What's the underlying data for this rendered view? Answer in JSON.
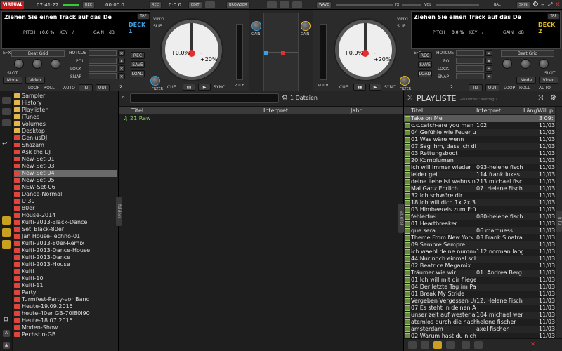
{
  "topbar": {
    "logo": "VIRTUAL DJ",
    "time": "07:41:22",
    "rec_label": "REC",
    "rec_time": "00:00.0",
    "mic_label": "REC",
    "mic_value": "0:0.0",
    "edit_label": "EDIT",
    "browser_label": "BROWSER",
    "wave_label": "WAVE",
    "vol_label": "VOL",
    "bal_label": "BAL",
    "skin_label": "SKIN"
  },
  "deck1": {
    "title": "Ziehen Sie einen Track auf das De",
    "tap": "TAP",
    "deck": "DECK 1",
    "pitch_label": "PITCH",
    "pitch_value": "+0.0 %",
    "key_label": "KEY",
    "key_value": "/",
    "gain_label": "GAIN",
    "gain_value": "dB",
    "fx_label": "EFX",
    "fx_select": "Beat Grid",
    "hotcue": "HOTCUE",
    "poi": "POI",
    "lock": "LOCK",
    "snap": "SNAP",
    "slot": "SLOT",
    "mode": "Mode",
    "video": "Video",
    "loop": "LOOP",
    "roll": "ROLL",
    "auto": "AUTO",
    "in": "IN",
    "out": "OUT",
    "loop_num": "2",
    "rec": "REC",
    "save": "SAVE",
    "load": "LOAD",
    "jog_left": "+0.0%",
    "jog_right": "-+20%",
    "cue": "CUE",
    "sync": "SYNC",
    "vinyl": "VINYL",
    "slip": "SLIP",
    "filter": "FILTER",
    "pitch_side": "PITCH",
    "gain_side": "GAIN"
  },
  "deck2": {
    "title": "Ziehen Sie einen Track auf das De",
    "tap": "TAP",
    "deck": "DECK 2",
    "pitch_label": "PITCH",
    "pitch_value": "+0.0 %",
    "key_label": "KEY",
    "key_value": "/",
    "gain_label": "GAIN",
    "gain_value": "dB",
    "fx_label": "EFX",
    "fx_select": "Beat Grid",
    "hotcue": "HOTCUE",
    "poi": "POI",
    "lock": "LOCK",
    "snap": "SNAP",
    "slot": "SLOT",
    "mode": "Mode",
    "video": "Video",
    "loop": "LOOP",
    "roll": "ROLL",
    "auto": "AUTO",
    "in": "IN",
    "out": "OUT",
    "loop_num": "2",
    "rec": "REC",
    "save": "SAVE",
    "load": "LOAD",
    "jog_left": "+0.0%",
    "jog_right": "-+20%",
    "cue": "CUE",
    "sync": "SYNC",
    "vinyl": "VINYL",
    "slip": "SLIP",
    "filter": "FILTER",
    "pitch_side": "PITCH",
    "gain_side": "GAIN"
  },
  "tree": [
    {
      "label": "Sampler",
      "icon": "folder-yel"
    },
    {
      "label": "History",
      "icon": "folder-yel"
    },
    {
      "label": "Playlisten",
      "icon": "folder-yel"
    },
    {
      "label": "iTunes",
      "icon": "folder-yel"
    },
    {
      "label": "Volumes",
      "icon": "folder-yel"
    },
    {
      "label": "Desktop",
      "icon": "folder-yel"
    },
    {
      "label": "GeniusDJ",
      "icon": "folder-red"
    },
    {
      "label": "Shazam",
      "icon": "folder-red"
    },
    {
      "label": "Ask the DJ",
      "icon": "folder-red"
    },
    {
      "label": "New-Set-01",
      "icon": "folder-red"
    },
    {
      "label": "New-Set-03",
      "icon": "folder-red"
    },
    {
      "label": "New-Set-04",
      "icon": "folder-red"
    },
    {
      "label": "New-Set-05",
      "icon": "folder-red"
    },
    {
      "label": "NEW-Set-06",
      "icon": "folder-red"
    },
    {
      "label": "Dance-Normal",
      "icon": "folder-red"
    },
    {
      "label": "U 30",
      "icon": "folder-red"
    },
    {
      "label": "80er",
      "icon": "folder-red"
    },
    {
      "label": "House-2014",
      "icon": "folder-red"
    },
    {
      "label": "Kulti-2013-Black-Dance",
      "icon": "folder-red"
    },
    {
      "label": "Set_Black-80er",
      "icon": "folder-red"
    },
    {
      "label": "Jan House-Techno-01",
      "icon": "folder-red"
    },
    {
      "label": "Kulti-2013-80er-Remix",
      "icon": "folder-red"
    },
    {
      "label": "Kulti-2013-Dance-House",
      "icon": "folder-red"
    },
    {
      "label": "Kulti-2013-Dance",
      "icon": "folder-red"
    },
    {
      "label": "Kulti-2013-House",
      "icon": "folder-red"
    },
    {
      "label": "Kulti",
      "icon": "folder-red"
    },
    {
      "label": "Kulti-10",
      "icon": "folder-red"
    },
    {
      "label": "Kulti-11",
      "icon": "folder-red"
    },
    {
      "label": "Party",
      "icon": "folder-red"
    },
    {
      "label": "Turmfest-Party-vor Band",
      "icon": "folder-red"
    },
    {
      "label": "Heute-19.09.2015",
      "icon": "folder-red"
    },
    {
      "label": "heute-40er GB-70I80I90",
      "icon": "folder-red"
    },
    {
      "label": "Heute-18.07.2015",
      "icon": "folder-red"
    },
    {
      "label": "Moden-Show",
      "icon": "folder-red"
    },
    {
      "label": "Pechstin-GB",
      "icon": "folder-red"
    }
  ],
  "main": {
    "file_count": "1 Dateien",
    "col_title": "Titel",
    "col_artist": "Interpret",
    "col_year": "Jahr",
    "rows": [
      {
        "title": "21 Raw",
        "artist": "",
        "year": ""
      }
    ],
    "folders_tab": "folders"
  },
  "playlist": {
    "title": "PLAYLISTE",
    "subtitle": "Gesamtzeit: Montag:1",
    "col_title": "Titel",
    "col_artist": "Interpret",
    "col_len": "Läng",
    "col_will": "Will p",
    "sidelist_tab": "sidelist",
    "info_tab": "info",
    "rows": [
      {
        "title": "Take on Me",
        "artist": "",
        "will": "3 09:"
      },
      {
        "title": "c.c.catch-are you man en",
        "artist": "102",
        "will": "11/03"
      },
      {
        "title": "04 Gefühle wie Feuer und",
        "artist": "",
        "will": "11/03"
      },
      {
        "title": "01 Was wäre wenn",
        "artist": "",
        "will": "11/03"
      },
      {
        "title": "07 Sag ihm, dass ich dich",
        "artist": "",
        "will": "11/03"
      },
      {
        "title": "03 Rettungsboot",
        "artist": "",
        "will": "11/03"
      },
      {
        "title": "20 Kornblumen",
        "artist": "",
        "will": "11/03"
      },
      {
        "title": "ich will immer wieder",
        "artist": "093-helene fische",
        "will": "11/03"
      },
      {
        "title": "leider geil",
        "artist": "114 frank lukas",
        "will": "11/03"
      },
      {
        "title": "deine liebe ist wahnsinn",
        "artist": "213 michael fische",
        "will": "11/03"
      },
      {
        "title": "Mal Ganz Ehrlich",
        "artist": "07. Helene Fische",
        "will": "11/03"
      },
      {
        "title": "32 Ich schwöre dir",
        "artist": "",
        "will": "11/03"
      },
      {
        "title": "18 Ich will dich 1x 2x 3x",
        "artist": "",
        "will": "11/03"
      },
      {
        "title": "03 Himbeereis zum Frühs",
        "artist": "",
        "will": "11/03"
      },
      {
        "title": "fehlerfrei",
        "artist": "080-helene fische",
        "will": "11/03"
      },
      {
        "title": "01 Heartbreaker",
        "artist": "",
        "will": "11/03"
      },
      {
        "title": "que sera",
        "artist": "06 marquess",
        "will": "11/03"
      },
      {
        "title": "Theme From New York N",
        "artist": "03 Frank Sinatra",
        "will": "11/03"
      },
      {
        "title": "09 Sempre Sempre",
        "artist": "",
        "will": "11/03"
      },
      {
        "title": "ich waehl deine nummer",
        "artist": "112 norman lange",
        "will": "11/03"
      },
      {
        "title": "44 Nur noch einmal schla",
        "artist": "",
        "will": "11/03"
      },
      {
        "title": "02 Beatrice Megamix",
        "artist": "",
        "will": "11/03"
      },
      {
        "title": "Träumer wie wir",
        "artist": "01. Andrea Berg",
        "will": "11/03"
      },
      {
        "title": "01 Ich will mit dir fliegen",
        "artist": "",
        "will": "11/03"
      },
      {
        "title": "04 Der letzte Tag im Para",
        "artist": "",
        "will": "11/03"
      },
      {
        "title": "01 Break My Stride",
        "artist": "",
        "will": "11/03"
      },
      {
        "title": "Vergeben Vergessen Und",
        "artist": "12. Helene Fische",
        "will": "11/03"
      },
      {
        "title": "07 Es steht in deinen Aug",
        "artist": "",
        "will": "11/03"
      },
      {
        "title": "unser zelt auf westerland",
        "artist": "104 michael wend",
        "will": "11/03"
      },
      {
        "title": "atemlos durch die nacht",
        "artist": "helene fischer",
        "will": "11/03"
      },
      {
        "title": "amsterdam",
        "artist": "axel fischer",
        "will": "11/03"
      },
      {
        "title": "02 Warum hast du nicht n",
        "artist": "",
        "will": "11/03"
      }
    ]
  },
  "colors": {
    "deck1": "#3aa0e0",
    "deck2": "#e8c020",
    "accent": "#e03030"
  }
}
